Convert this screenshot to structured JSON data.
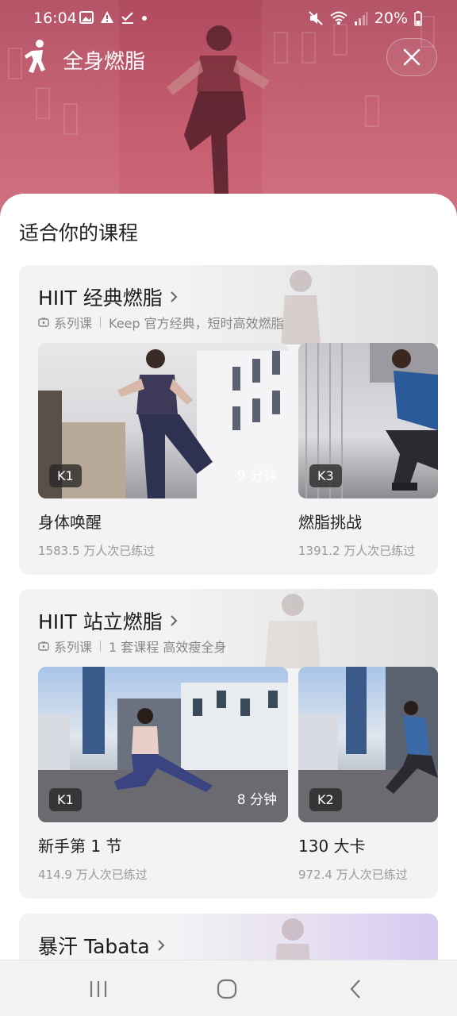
{
  "status_bar": {
    "time": "16:04",
    "battery": "20%",
    "icons": [
      "image-icon",
      "warning-icon",
      "check-icon",
      "dot-icon",
      "mute-icon",
      "wifi-icon",
      "signal-icon",
      "battery-icon"
    ]
  },
  "header": {
    "title": "全身燃脂",
    "runner_icon": "runner-icon",
    "close_icon": "close-icon"
  },
  "main": {
    "section_title": "适合你的课程",
    "series": [
      {
        "title": "HIIT 经典燃脂",
        "type_label": "系列课",
        "description": "Keep 官方经典，短时高效燃脂",
        "courses": [
          {
            "level": "K1",
            "duration": "9 分钟",
            "name": "身体唤醒",
            "count": "1583.5 万人次已练过"
          },
          {
            "level": "K3",
            "duration": "",
            "name": "燃脂挑战",
            "count": "1391.2 万人次已练过"
          }
        ]
      },
      {
        "title": "HIIT 站立燃脂",
        "type_label": "系列课",
        "description": "1 套课程 高效瘦全身",
        "courses": [
          {
            "level": "K1",
            "duration": "8 分钟",
            "name": "新手第 1 节",
            "count": "414.9 万人次已练过"
          },
          {
            "level": "K2",
            "duration": "",
            "name": "130 大卡",
            "count": "972.4 万人次已练过"
          }
        ]
      },
      {
        "title": "暴汗 Tabata",
        "type_label": "",
        "description": "",
        "courses": []
      }
    ]
  },
  "nav": {
    "icons": [
      "recent-apps-icon",
      "home-icon",
      "back-icon"
    ]
  },
  "colors": {
    "hero": "#b84a60",
    "card_bg": "#f3f3f4",
    "badge_bg": "#333333"
  }
}
